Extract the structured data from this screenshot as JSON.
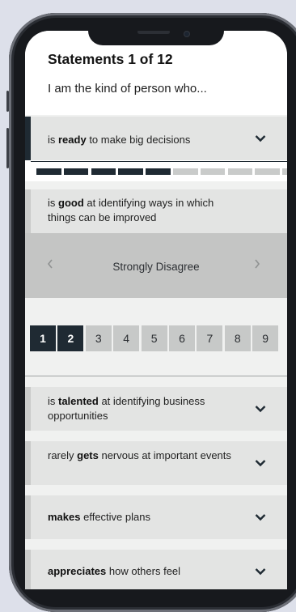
{
  "header": {
    "title": "Statements 1 of 12",
    "subtitle": "I am the kind of person who..."
  },
  "colors": {
    "progress_filled": "#1f2a33",
    "progress_empty": "#c9cbca",
    "selected_box": "#1f2a33",
    "unselected_box": "#c7c9c8"
  },
  "statements": [
    {
      "prefix": "is ",
      "bold": "ready",
      "suffix": " to make big decisions",
      "state": "answered",
      "icon": "chevron-down-icon"
    },
    {
      "prefix": "is ",
      "bold": "good",
      "suffix": " at identifying ways in which things can be improved",
      "state": "active"
    },
    {
      "prefix": "is ",
      "bold": "talented",
      "suffix": " at identifying business opportunities",
      "icon": "chevron-down-icon"
    },
    {
      "prefix": "rarely ",
      "bold": "gets",
      "suffix": " nervous at important events",
      "icon": "chevron-down-icon"
    },
    {
      "prefix": "",
      "bold": "makes",
      "suffix": " effective plans",
      "icon": "chevron-down-icon"
    },
    {
      "prefix": "",
      "bold": "appreciates",
      "suffix": " how others feel",
      "icon": "chevron-down-icon"
    }
  ],
  "progress": {
    "completed": 5,
    "total": 10
  },
  "selector": {
    "current_label": "Strongly Disagree",
    "prev_icon": "chevron-left-icon",
    "next_icon": "chevron-right-icon"
  },
  "scale": {
    "options": [
      "1",
      "2",
      "3",
      "4",
      "5",
      "6",
      "7",
      "8",
      "9"
    ],
    "selected_through": 2
  }
}
